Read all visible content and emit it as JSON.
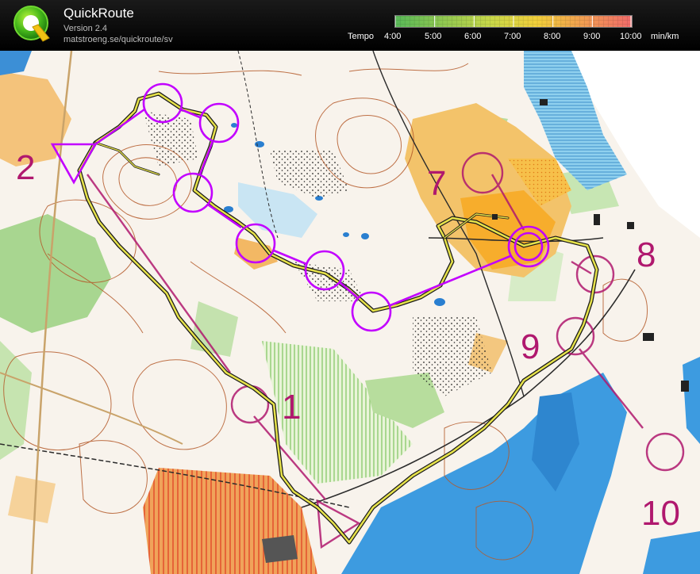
{
  "app": {
    "title": "QuickRoute",
    "version": "Version 2.4",
    "url": "matstroeng.se/quickroute/sv",
    "logo_letter": "Q"
  },
  "legend": {
    "label": "Tempo",
    "ticks": [
      "4:00",
      "5:00",
      "6:00",
      "7:00",
      "8:00",
      "9:00",
      "10:00"
    ],
    "unit": "min/km",
    "colors": {
      "fast": "#4cbb4c",
      "mid": "#f2d33a",
      "slow": "#f05a5a"
    }
  },
  "map": {
    "controls": [
      "1",
      "2",
      "7",
      "8",
      "9",
      "10"
    ],
    "colors": {
      "course": "#c200ff",
      "print_course": "#b0186e",
      "route": "#e8e84a",
      "water": "#3d9be0",
      "open_land": "#f5b041",
      "forest": "#ffffff",
      "green": "#9ccf7a",
      "contour": "#b45a2a"
    }
  }
}
